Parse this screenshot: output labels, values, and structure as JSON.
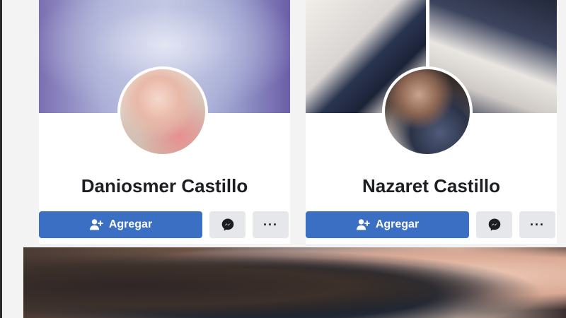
{
  "profiles": [
    {
      "name": "Daniosmer Castillo",
      "add_button_label": "Agregar",
      "messenger_icon": "messenger-icon",
      "more_icon": "more-dots-icon",
      "more_label": "···"
    },
    {
      "name": "Nazaret Castillo",
      "add_button_label": "Agregar",
      "messenger_icon": "messenger-icon",
      "more_icon": "more-dots-icon",
      "more_label": "···"
    }
  ],
  "colors": {
    "primary_button": "#3b6fc4",
    "secondary_button": "#e6e7ea",
    "name_text": "#1c1e21",
    "card_background": "#ffffff"
  }
}
